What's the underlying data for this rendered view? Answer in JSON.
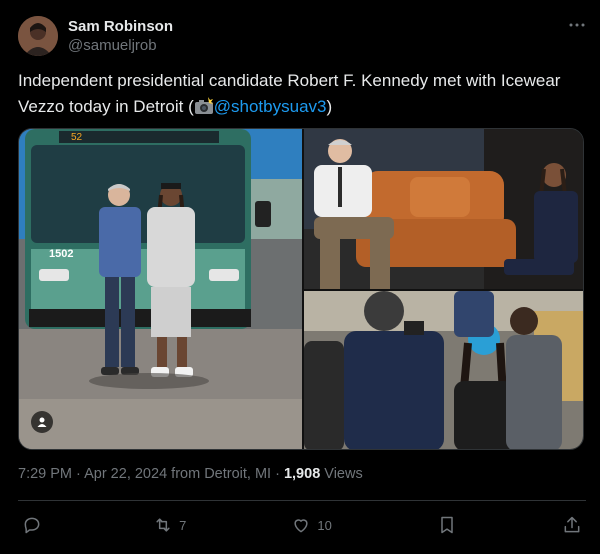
{
  "author": {
    "display_name": "Sam Robinson",
    "handle": "@samueljrob"
  },
  "tweet": {
    "text_before": "Independent presidential candidate Robert F. Kennedy met with Icewear Vezzo today in Detroit (",
    "mention": "@shotbysuav3",
    "text_after": ")"
  },
  "meta": {
    "time": "7:29 PM",
    "sep1": " · ",
    "date": "Apr 22, 2024",
    "location": " from Detroit, MI",
    "sep2": " · ",
    "views_count": "1,908",
    "views_label": " Views"
  },
  "actions": {
    "reply_count": "",
    "retweet_count": "7",
    "like_count": "10"
  },
  "media": {
    "photo1_caption": "",
    "bus_sign": "52",
    "bus_number": "1502"
  },
  "icons": {
    "more": "more-icon",
    "reply": "reply-icon",
    "retweet": "retweet-icon",
    "like": "heart-icon",
    "bookmark": "bookmark-icon",
    "share": "share-icon"
  },
  "colors": {
    "background": "#000000",
    "text": "#e7e9ea",
    "muted": "#71767b",
    "link": "#1d9bf0",
    "border": "#2f3336"
  }
}
